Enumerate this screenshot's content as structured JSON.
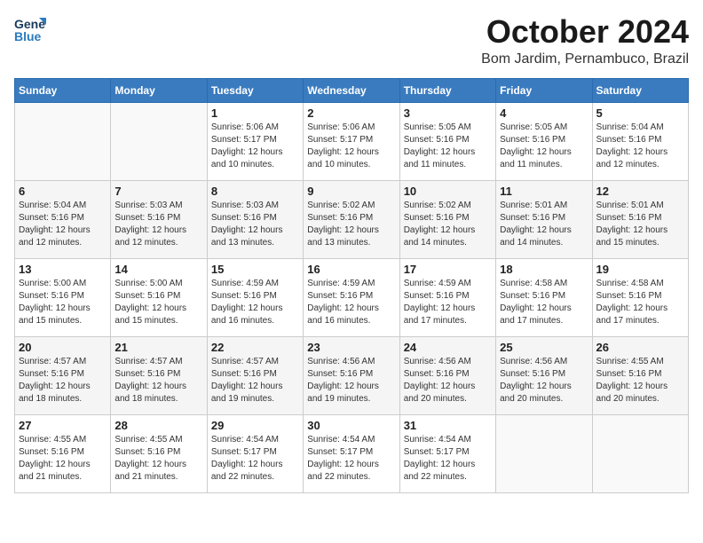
{
  "logo": {
    "line1": "General",
    "line2": "Blue"
  },
  "title": "October 2024",
  "location": "Bom Jardim, Pernambuco, Brazil",
  "days_of_week": [
    "Sunday",
    "Monday",
    "Tuesday",
    "Wednesday",
    "Thursday",
    "Friday",
    "Saturday"
  ],
  "weeks": [
    [
      {
        "day": "",
        "sunrise": "",
        "sunset": "",
        "daylight": ""
      },
      {
        "day": "",
        "sunrise": "",
        "sunset": "",
        "daylight": ""
      },
      {
        "day": "1",
        "sunrise": "Sunrise: 5:06 AM",
        "sunset": "Sunset: 5:17 PM",
        "daylight": "Daylight: 12 hours and 10 minutes."
      },
      {
        "day": "2",
        "sunrise": "Sunrise: 5:06 AM",
        "sunset": "Sunset: 5:17 PM",
        "daylight": "Daylight: 12 hours and 10 minutes."
      },
      {
        "day": "3",
        "sunrise": "Sunrise: 5:05 AM",
        "sunset": "Sunset: 5:16 PM",
        "daylight": "Daylight: 12 hours and 11 minutes."
      },
      {
        "day": "4",
        "sunrise": "Sunrise: 5:05 AM",
        "sunset": "Sunset: 5:16 PM",
        "daylight": "Daylight: 12 hours and 11 minutes."
      },
      {
        "day": "5",
        "sunrise": "Sunrise: 5:04 AM",
        "sunset": "Sunset: 5:16 PM",
        "daylight": "Daylight: 12 hours and 12 minutes."
      }
    ],
    [
      {
        "day": "6",
        "sunrise": "Sunrise: 5:04 AM",
        "sunset": "Sunset: 5:16 PM",
        "daylight": "Daylight: 12 hours and 12 minutes."
      },
      {
        "day": "7",
        "sunrise": "Sunrise: 5:03 AM",
        "sunset": "Sunset: 5:16 PM",
        "daylight": "Daylight: 12 hours and 12 minutes."
      },
      {
        "day": "8",
        "sunrise": "Sunrise: 5:03 AM",
        "sunset": "Sunset: 5:16 PM",
        "daylight": "Daylight: 12 hours and 13 minutes."
      },
      {
        "day": "9",
        "sunrise": "Sunrise: 5:02 AM",
        "sunset": "Sunset: 5:16 PM",
        "daylight": "Daylight: 12 hours and 13 minutes."
      },
      {
        "day": "10",
        "sunrise": "Sunrise: 5:02 AM",
        "sunset": "Sunset: 5:16 PM",
        "daylight": "Daylight: 12 hours and 14 minutes."
      },
      {
        "day": "11",
        "sunrise": "Sunrise: 5:01 AM",
        "sunset": "Sunset: 5:16 PM",
        "daylight": "Daylight: 12 hours and 14 minutes."
      },
      {
        "day": "12",
        "sunrise": "Sunrise: 5:01 AM",
        "sunset": "Sunset: 5:16 PM",
        "daylight": "Daylight: 12 hours and 15 minutes."
      }
    ],
    [
      {
        "day": "13",
        "sunrise": "Sunrise: 5:00 AM",
        "sunset": "Sunset: 5:16 PM",
        "daylight": "Daylight: 12 hours and 15 minutes."
      },
      {
        "day": "14",
        "sunrise": "Sunrise: 5:00 AM",
        "sunset": "Sunset: 5:16 PM",
        "daylight": "Daylight: 12 hours and 15 minutes."
      },
      {
        "day": "15",
        "sunrise": "Sunrise: 4:59 AM",
        "sunset": "Sunset: 5:16 PM",
        "daylight": "Daylight: 12 hours and 16 minutes."
      },
      {
        "day": "16",
        "sunrise": "Sunrise: 4:59 AM",
        "sunset": "Sunset: 5:16 PM",
        "daylight": "Daylight: 12 hours and 16 minutes."
      },
      {
        "day": "17",
        "sunrise": "Sunrise: 4:59 AM",
        "sunset": "Sunset: 5:16 PM",
        "daylight": "Daylight: 12 hours and 17 minutes."
      },
      {
        "day": "18",
        "sunrise": "Sunrise: 4:58 AM",
        "sunset": "Sunset: 5:16 PM",
        "daylight": "Daylight: 12 hours and 17 minutes."
      },
      {
        "day": "19",
        "sunrise": "Sunrise: 4:58 AM",
        "sunset": "Sunset: 5:16 PM",
        "daylight": "Daylight: 12 hours and 17 minutes."
      }
    ],
    [
      {
        "day": "20",
        "sunrise": "Sunrise: 4:57 AM",
        "sunset": "Sunset: 5:16 PM",
        "daylight": "Daylight: 12 hours and 18 minutes."
      },
      {
        "day": "21",
        "sunrise": "Sunrise: 4:57 AM",
        "sunset": "Sunset: 5:16 PM",
        "daylight": "Daylight: 12 hours and 18 minutes."
      },
      {
        "day": "22",
        "sunrise": "Sunrise: 4:57 AM",
        "sunset": "Sunset: 5:16 PM",
        "daylight": "Daylight: 12 hours and 19 minutes."
      },
      {
        "day": "23",
        "sunrise": "Sunrise: 4:56 AM",
        "sunset": "Sunset: 5:16 PM",
        "daylight": "Daylight: 12 hours and 19 minutes."
      },
      {
        "day": "24",
        "sunrise": "Sunrise: 4:56 AM",
        "sunset": "Sunset: 5:16 PM",
        "daylight": "Daylight: 12 hours and 20 minutes."
      },
      {
        "day": "25",
        "sunrise": "Sunrise: 4:56 AM",
        "sunset": "Sunset: 5:16 PM",
        "daylight": "Daylight: 12 hours and 20 minutes."
      },
      {
        "day": "26",
        "sunrise": "Sunrise: 4:55 AM",
        "sunset": "Sunset: 5:16 PM",
        "daylight": "Daylight: 12 hours and 20 minutes."
      }
    ],
    [
      {
        "day": "27",
        "sunrise": "Sunrise: 4:55 AM",
        "sunset": "Sunset: 5:16 PM",
        "daylight": "Daylight: 12 hours and 21 minutes."
      },
      {
        "day": "28",
        "sunrise": "Sunrise: 4:55 AM",
        "sunset": "Sunset: 5:16 PM",
        "daylight": "Daylight: 12 hours and 21 minutes."
      },
      {
        "day": "29",
        "sunrise": "Sunrise: 4:54 AM",
        "sunset": "Sunset: 5:17 PM",
        "daylight": "Daylight: 12 hours and 22 minutes."
      },
      {
        "day": "30",
        "sunrise": "Sunrise: 4:54 AM",
        "sunset": "Sunset: 5:17 PM",
        "daylight": "Daylight: 12 hours and 22 minutes."
      },
      {
        "day": "31",
        "sunrise": "Sunrise: 4:54 AM",
        "sunset": "Sunset: 5:17 PM",
        "daylight": "Daylight: 12 hours and 22 minutes."
      },
      {
        "day": "",
        "sunrise": "",
        "sunset": "",
        "daylight": ""
      },
      {
        "day": "",
        "sunrise": "",
        "sunset": "",
        "daylight": ""
      }
    ]
  ]
}
